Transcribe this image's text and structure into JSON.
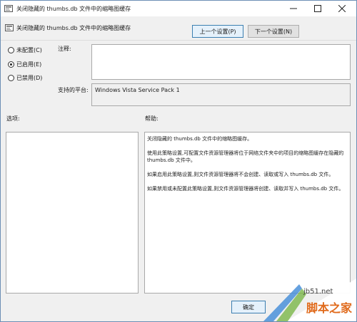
{
  "window": {
    "title": "关闭隐藏的 thumbs.db 文件中的缩略图缓存"
  },
  "header": {
    "setting_name": "关闭隐藏的 thumbs.db 文件中的缩略图缓存",
    "prev_button": "上一个设置(P)",
    "next_button": "下一个设置(N)"
  },
  "state": {
    "options": [
      {
        "label": "未配置(C)",
        "checked": false
      },
      {
        "label": "已启用(E)",
        "checked": true
      },
      {
        "label": "已禁用(D)",
        "checked": false
      }
    ]
  },
  "fields": {
    "comment_label": "注释:",
    "comment_value": "",
    "platform_label": "支持的平台:",
    "platform_value": "Windows Vista Service Pack 1"
  },
  "panels": {
    "options_label": "选项:",
    "help_label": "帮助:",
    "help_paragraphs": [
      "关闭隐藏的 thumbs.db 文件中的缩略图缓存。",
      "使用此策略设置,可配置文件资源管理器将位于网络文件夹中的项目的缩略图缓存在隐藏的 thumbs.db 文件中。",
      "如果启用此策略设置,则文件资源管理器将不会创建、读取或写入 thumbs.db 文件。",
      "如果禁用或未配置此策略设置,则文件资源管理器将创建、读取并写入 thumbs.db 文件。"
    ]
  },
  "footer": {
    "ok_button": "确定"
  },
  "watermark": {
    "site": "jb51.net",
    "name": "脚本之家"
  }
}
